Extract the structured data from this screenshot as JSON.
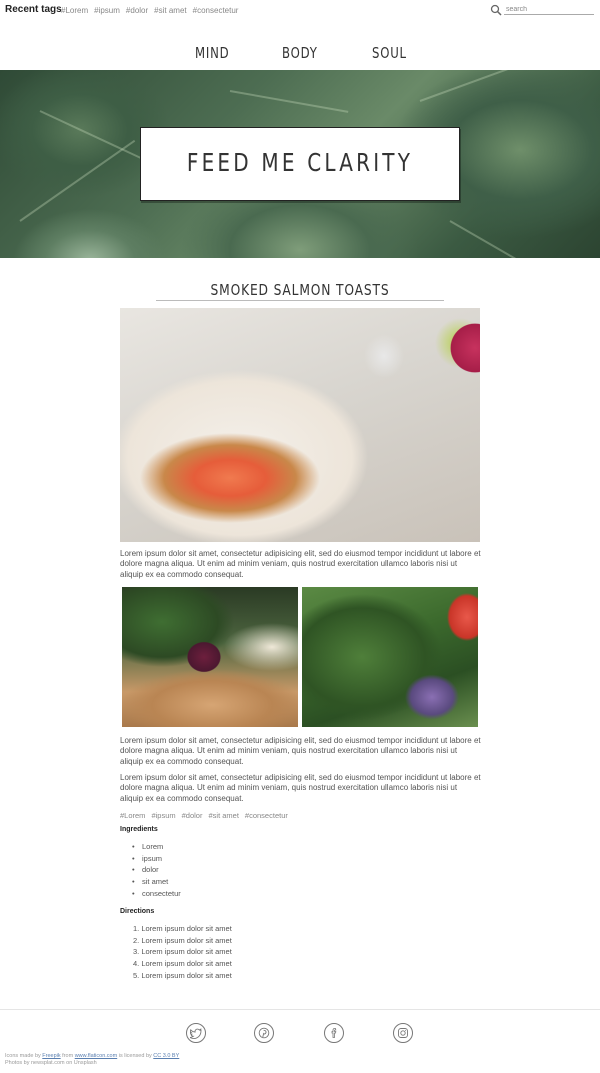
{
  "topbar": {
    "recent_tags_label": "Recent tags",
    "tags": [
      "#Lorem",
      "#ipsum",
      "#dolor",
      "#sit amet",
      "#consectetur"
    ],
    "search_placeholder": "search"
  },
  "nav": {
    "items": [
      {
        "label": "MIND"
      },
      {
        "label": "BODY"
      },
      {
        "label": "SOUL"
      }
    ]
  },
  "hero": {
    "title": "FEED ME CLARITY"
  },
  "post": {
    "title": "SMOKED SALMON TOASTS",
    "paragraph1": "Lorem ipsum dolor sit amet, consectetur adipisicing elit, sed do eiusmod tempor incididunt ut labore et dolore magna aliqua. Ut enim ad minim veniam, quis nostrud exercitation ullamco laboris nisi ut aliquip ex ea commodo consequat.",
    "paragraph2": "Lorem ipsum dolor sit amet, consectetur adipisicing elit, sed do eiusmod tempor incididunt ut labore et dolore magna aliqua. Ut enim ad minim veniam, quis nostrud exercitation ullamco laboris nisi ut aliquip ex ea commodo consequat.",
    "paragraph3": "Lorem ipsum dolor sit amet, consectetur adipisicing elit, sed do eiusmod tempor incididunt ut labore et dolore magna aliqua. Ut enim ad minim veniam, quis nostrud exercitation ullamco laboris nisi ut aliquip ex ea commodo consequat.",
    "tags": [
      "#Lorem",
      "#ipsum",
      "#dolor",
      "#sit amet",
      "#consectetur"
    ],
    "ingredients_heading": "Ingredients",
    "ingredients": [
      "Lorem",
      "ipsum",
      "dolor",
      "sit amet",
      "consectetur"
    ],
    "directions_heading": "Directions",
    "directions": [
      "1. Lorem ipsum dolor sit amet",
      "2. Lorem ipsum dolor sit amet",
      "3. Lorem ipsum dolor sit amet",
      "4. Lorem ipsum dolor sit amet",
      "5. Lorem ipsum dolor sit amet"
    ]
  },
  "footer": {
    "social": [
      {
        "icon": "twitter-icon"
      },
      {
        "icon": "pinterest-icon"
      },
      {
        "icon": "facebook-icon"
      },
      {
        "icon": "instagram-icon"
      }
    ],
    "credits_icons_prefix": "Icons made by ",
    "credits_freepik": "Freepik",
    "credits_from": " from ",
    "credits_flaticon": "www.flaticon.com",
    "credits_licensed": " is licensed by ",
    "credits_cc": "CC 3.0 BY",
    "credits_photos": "Photos by newsplat.com on Unsplash"
  },
  "colors": {
    "text": "#333333",
    "muted": "#888888",
    "link": "#5a7fb0"
  }
}
